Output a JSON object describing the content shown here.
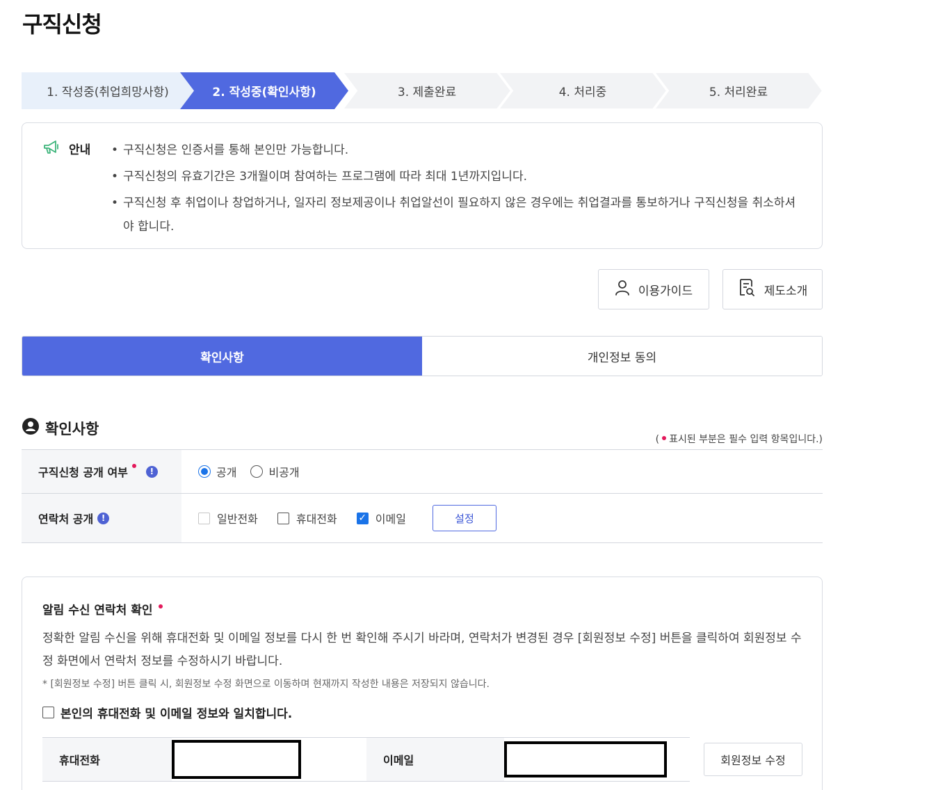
{
  "page": {
    "title": "구직신청"
  },
  "steps": [
    {
      "label": "1. 작성중(취업희망사항)",
      "state": "done"
    },
    {
      "label": "2. 작성중(확인사항)",
      "state": "active"
    },
    {
      "label": "3. 제출완료",
      "state": "pending"
    },
    {
      "label": "4. 처리중",
      "state": "pending"
    },
    {
      "label": "5. 처리완료",
      "state": "pending"
    }
  ],
  "notice": {
    "label": "안내",
    "items": [
      "구직신청은 인증서를 통해 본인만 가능합니다.",
      "구직신청의 유효기간은 3개월이며 참여하는 프로그램에 따라 최대 1년까지입니다.",
      "구직신청 후 취업이나 창업하거나, 일자리 정보제공이나 취업알선이 필요하지 않은 경우에는 취업결과를 통보하거나 구직신청을 취소하셔야 합니다."
    ]
  },
  "buttons": {
    "guide": "이용가이드",
    "system": "제도소개"
  },
  "tabs": [
    {
      "label": "확인사항",
      "active": true
    },
    {
      "label": "개인정보 동의",
      "active": false
    }
  ],
  "section": {
    "title": "확인사항",
    "required_note_prefix": "(",
    "required_note_text": "표시된 부분은 필수 입력 항목입니다.)"
  },
  "form": {
    "disclosure": {
      "label": "구직신청 공개 여부",
      "options": [
        {
          "label": "공개",
          "checked": true
        },
        {
          "label": "비공개",
          "checked": false
        }
      ]
    },
    "contact": {
      "label": "연락처 공개",
      "options": [
        {
          "label": "일반전화",
          "checked": false,
          "disabled": true
        },
        {
          "label": "휴대전화",
          "checked": false,
          "disabled": false
        },
        {
          "label": "이메일",
          "checked": true,
          "disabled": false
        }
      ],
      "set_button": "설정"
    }
  },
  "alert_contact": {
    "title": "알림 수신 연락처 확인",
    "description": "정확한 알림 수신을 위해 휴대전화 및 이메일 정보를 다시 한 번 확인해 주시기 바라며, 연락처가 변경된 경우 [회원정보 수정] 버튼을 클릭하여 회원정보 수정 화면에서 연락처 정보를 수정하시기 바랍니다.",
    "note": "* [회원정보 수정] 버튼 클릭 시, 회원정보 수정 화면으로 이동하며 현재까지 작성한 내용은 저장되지 않습니다.",
    "confirm_label": "본인의 휴대전화 및 이메일 정보와 일치합니다.",
    "confirm_checked": false,
    "phone_label": "휴대전화",
    "email_label": "이메일",
    "edit_button": "회원정보 수정"
  },
  "colors": {
    "accent": "#5069e0",
    "step_done": "#e8f0fa",
    "step_pending": "#f2f3f5",
    "required": "#e3195b",
    "checkbox": "#1a73e8"
  }
}
